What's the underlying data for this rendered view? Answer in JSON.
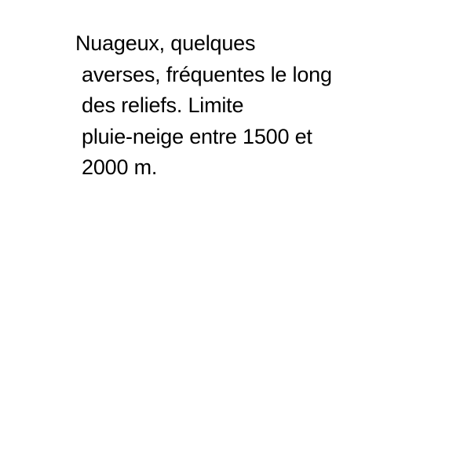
{
  "forecast": {
    "lines": [
      "Nuageux, quelques",
      "averses, fréquentes le long",
      "des reliefs. Limite",
      "pluie-neige entre 1500 et",
      "2000 m."
    ]
  },
  "colors": {
    "background": "#ffffff",
    "text": "#000000"
  }
}
